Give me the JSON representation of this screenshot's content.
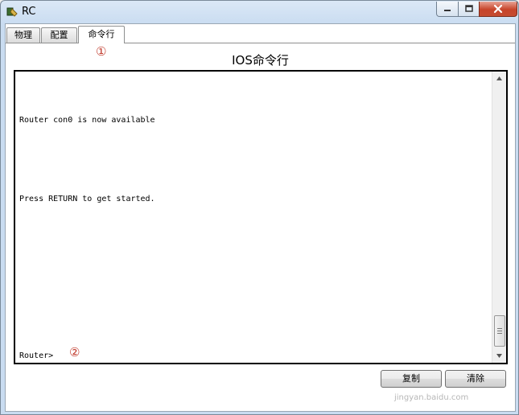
{
  "window": {
    "title": "RC",
    "controls": {
      "minimize": "minimize-icon",
      "maximize": "maximize-icon",
      "close": "close-icon"
    }
  },
  "tabs": [
    {
      "label": "物理"
    },
    {
      "label": "配置"
    },
    {
      "label": "命令行",
      "active": true
    }
  ],
  "annotations": {
    "first": "①",
    "second": "②"
  },
  "panel": {
    "title": "IOS命令行"
  },
  "terminal": {
    "lines": [
      "Router con0 is now available",
      "Press RETURN to get started.",
      "Router>"
    ]
  },
  "buttons": {
    "copy": "复制",
    "clear": "清除"
  },
  "watermark": "jingyan.baidu.com",
  "colors": {
    "annotation": "#c0392b",
    "close_button": "#c7442a"
  }
}
